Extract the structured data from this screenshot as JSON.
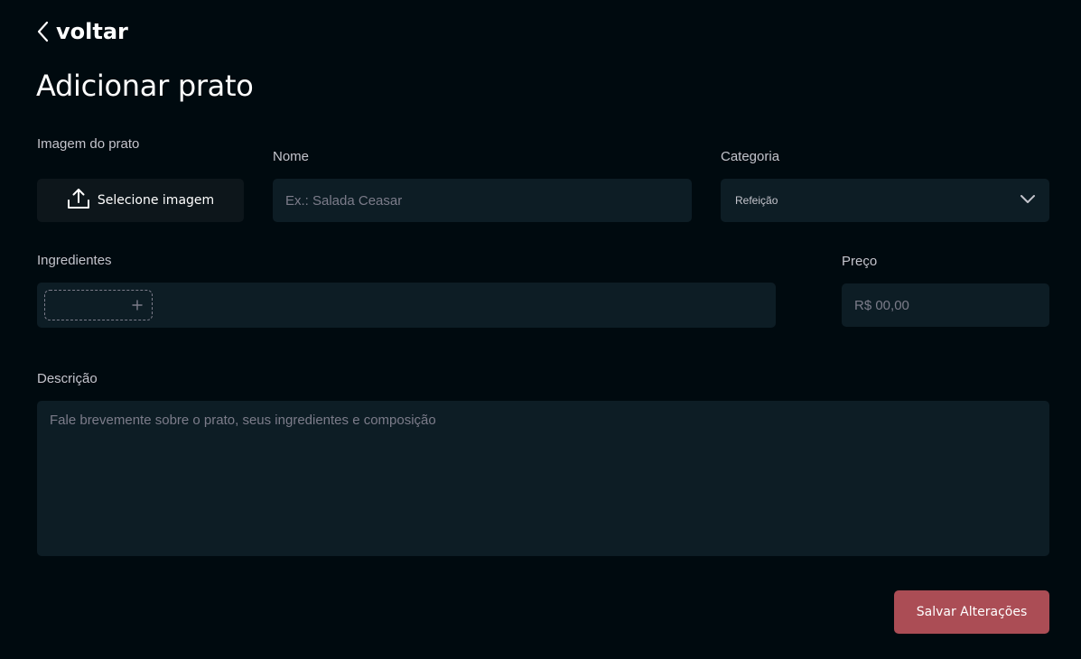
{
  "header": {
    "back_label": "voltar",
    "title": "Adicionar prato"
  },
  "form": {
    "image": {
      "label": "Imagem do prato",
      "button_label": "Selecione imagem"
    },
    "name": {
      "label": "Nome",
      "placeholder": "Ex.: Salada Ceasar",
      "value": ""
    },
    "category": {
      "label": "Categoria",
      "selected": "Refeição"
    },
    "ingredients": {
      "label": "Ingredientes",
      "new_tag_icon": "plus-icon"
    },
    "price": {
      "label": "Preço",
      "placeholder": "R$ 00,00",
      "value": ""
    },
    "description": {
      "label": "Descrição",
      "placeholder": "Fale brevemente sobre o prato, seus ingredientes e composição",
      "value": ""
    },
    "save_label": "Salvar Alterações"
  },
  "colors": {
    "background": "#000a0f",
    "input_bg": "#0d1d25",
    "upload_bg": "#0d161b",
    "accent": "#ab4d55"
  }
}
